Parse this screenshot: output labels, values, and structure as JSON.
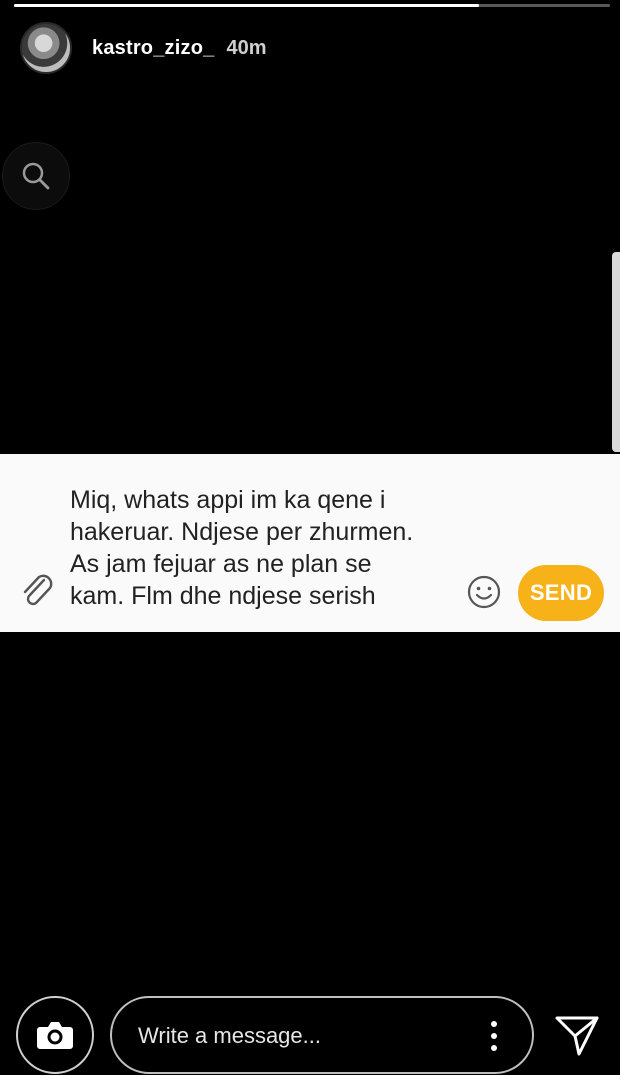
{
  "story": {
    "progress_fraction": 0.78,
    "username": "kastro_zizo_",
    "time_ago": "40m"
  },
  "message_card": {
    "text": "Miq, whats appi im ka qene i\nhakeruar. Ndjese per zhurmen.\nAs jam fejuar as ne plan se\nkam. Flm dhe ndjese serish",
    "send_label": "SEND",
    "accent_color": "#f7b21a"
  },
  "reply_bar": {
    "placeholder": "Write a message..."
  },
  "icons": {
    "search": "search-icon",
    "attach": "paperclip-icon",
    "emoji": "smiley-icon",
    "camera": "camera-icon",
    "more": "more-vertical-icon",
    "send": "paper-plane-icon"
  }
}
